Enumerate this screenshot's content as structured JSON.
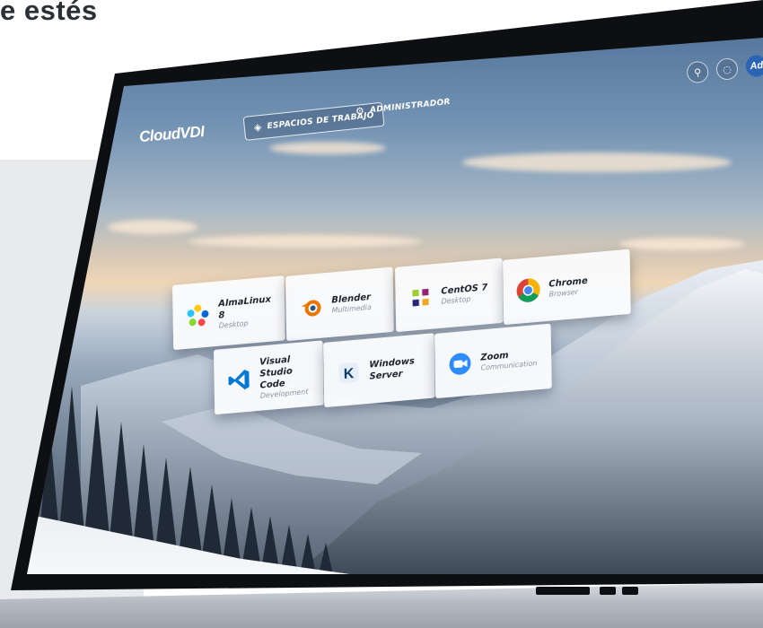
{
  "page_heading": "e estés",
  "app": {
    "brand": "CloudVDI",
    "nav": [
      {
        "label": "ESPACIOS DE TRABAJO",
        "icon": "layers-icon",
        "active": true
      },
      {
        "label": "ADMINISTRADOR",
        "icon": "gear-icon",
        "active": false
      }
    ],
    "actions": {
      "search_icon": "search-icon",
      "settings_icon": "settings-icon",
      "avatar_initials": "Ad"
    }
  },
  "workspaces": [
    {
      "name": "AlmaLinux 8",
      "category": "Desktop",
      "icon": "almalinux-icon"
    },
    {
      "name": "Blender",
      "category": "Multimedia",
      "icon": "blender-icon"
    },
    {
      "name": "CentOS 7",
      "category": "Desktop",
      "icon": "centos-icon"
    },
    {
      "name": "Chrome",
      "category": "Browser",
      "icon": "chrome-icon"
    },
    {
      "name": "Visual Studio Code",
      "category": "Development",
      "icon": "vscode-icon"
    },
    {
      "name": "Windows Server",
      "category": "",
      "icon": "windows-server-icon"
    },
    {
      "name": "Zoom",
      "category": "Communication",
      "icon": "zoom-icon"
    }
  ],
  "colors": {
    "accent": "#2a64b3",
    "bezel": "#0d0f12"
  }
}
